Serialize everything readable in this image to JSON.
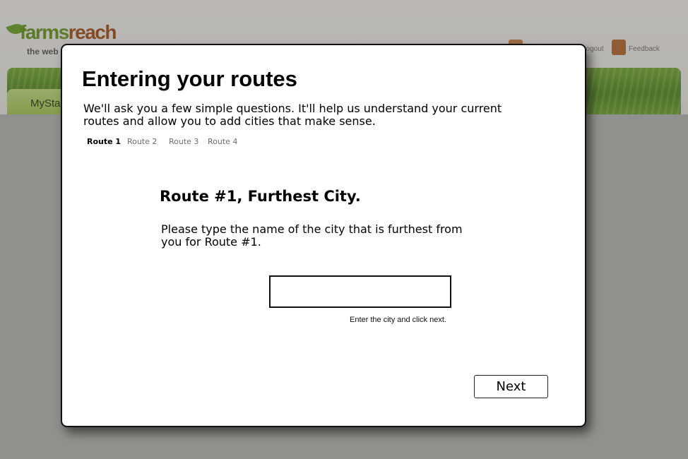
{
  "background": {
    "logo": {
      "word_green": "farms",
      "word_brown": "reach",
      "tagline": "the web"
    },
    "top_links": {
      "logout": "Logout",
      "feedback": "Feedback"
    },
    "nav_tab_label": "MySta",
    "colors": {
      "brand_green": "#6a9a1f",
      "brand_brown": "#a8521c",
      "nav_green": "#5c9225"
    }
  },
  "modal": {
    "title": "Entering your routes",
    "intro": "We'll ask you a few simple questions. It'll help us understand your current routes and allow you to add cities that make sense.",
    "route_tabs": [
      {
        "label": "Route 1",
        "active": true
      },
      {
        "label": "Route 2",
        "active": false
      },
      {
        "label": "Route 3",
        "active": false
      },
      {
        "label": "Route 4",
        "active": false
      }
    ],
    "step_title": "Route #1, Furthest City.",
    "step_text": "Please type the name of the city that is furthest from you for Route #1.",
    "city_input": {
      "value": "",
      "placeholder": ""
    },
    "input_hint": "Enter the city and click next.",
    "next_label": "Next"
  }
}
